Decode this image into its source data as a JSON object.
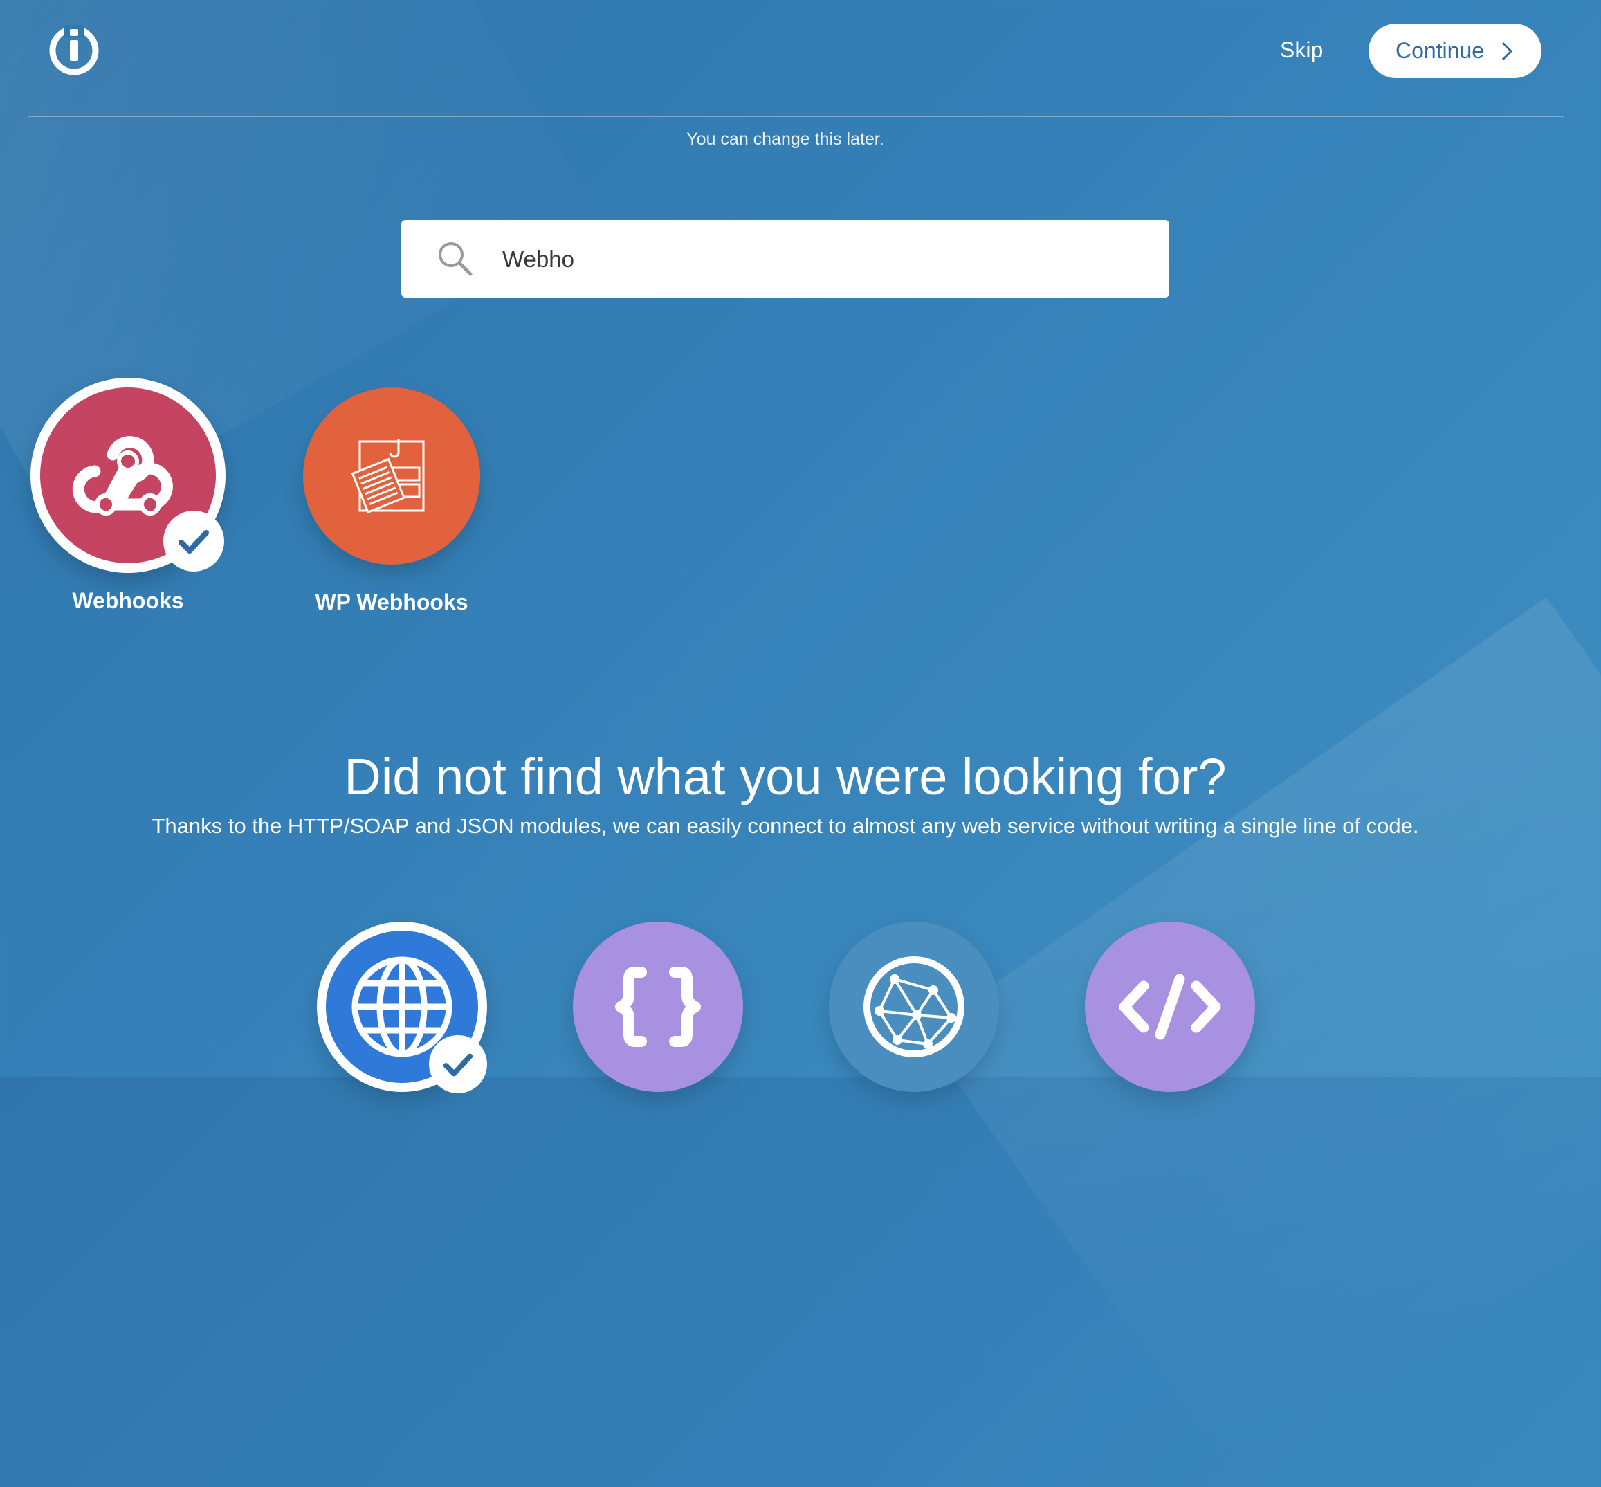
{
  "header": {
    "skip_label": "Skip",
    "continue_label": "Continue"
  },
  "hint": "You can change this later.",
  "search": {
    "value": "Webho",
    "placeholder": ""
  },
  "results": [
    {
      "label": "Webhooks",
      "selected": true,
      "icon": "webhooks-icon",
      "color": "#c44462"
    },
    {
      "label": "WP Webhooks",
      "selected": false,
      "icon": "wp-webhooks-icon",
      "color": "#e1623c"
    }
  ],
  "help": {
    "title": "Did not find what you were looking for?",
    "subtitle": "Thanks to the HTTP/SOAP and JSON modules, we can easily connect to almost any web service without writing a single line of code."
  },
  "modules": [
    {
      "icon": "globe-icon",
      "selected": true,
      "color": "#2f7ad8"
    },
    {
      "icon": "json-braces-icon",
      "selected": false,
      "color": "#a791e0"
    },
    {
      "icon": "network-icon",
      "selected": false,
      "color": "#4a8dbf"
    },
    {
      "icon": "code-tag-icon",
      "selected": false,
      "color": "#a791e0"
    }
  ]
}
